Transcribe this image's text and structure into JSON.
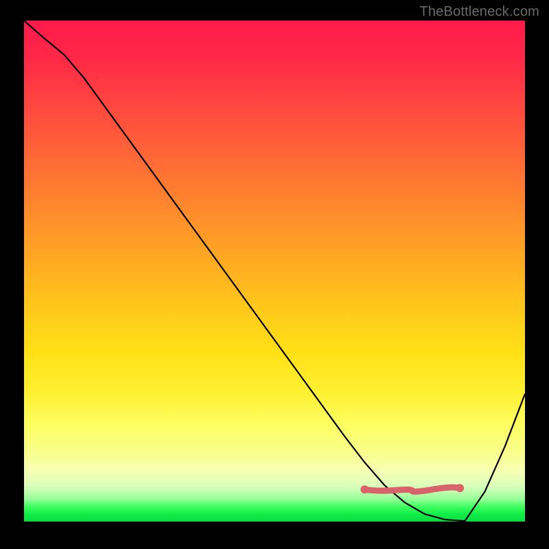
{
  "watermark": "TheBottleneck.com",
  "chart_data": {
    "type": "line",
    "title": "",
    "xlabel": "",
    "ylabel": "",
    "x": [
      0.0,
      0.04,
      0.08,
      0.12,
      0.16,
      0.2,
      0.24,
      0.28,
      0.32,
      0.36,
      0.4,
      0.44,
      0.48,
      0.52,
      0.56,
      0.6,
      0.64,
      0.68,
      0.72,
      0.76,
      0.8,
      0.84,
      0.88,
      0.92,
      0.96,
      1.0
    ],
    "values": [
      1.0,
      0.965,
      0.932,
      0.885,
      0.83,
      0.775,
      0.72,
      0.665,
      0.61,
      0.555,
      0.5,
      0.445,
      0.39,
      0.335,
      0.28,
      0.225,
      0.17,
      0.118,
      0.072,
      0.038,
      0.015,
      0.004,
      0.001,
      0.06,
      0.15,
      0.255
    ],
    "xlim": [
      0,
      1
    ],
    "ylim": [
      0,
      1
    ],
    "annotations": {
      "highlight_band_x": [
        0.68,
        0.87
      ],
      "highlight_band_y": 0.064
    },
    "background": "rainbow-vertical-gradient"
  }
}
